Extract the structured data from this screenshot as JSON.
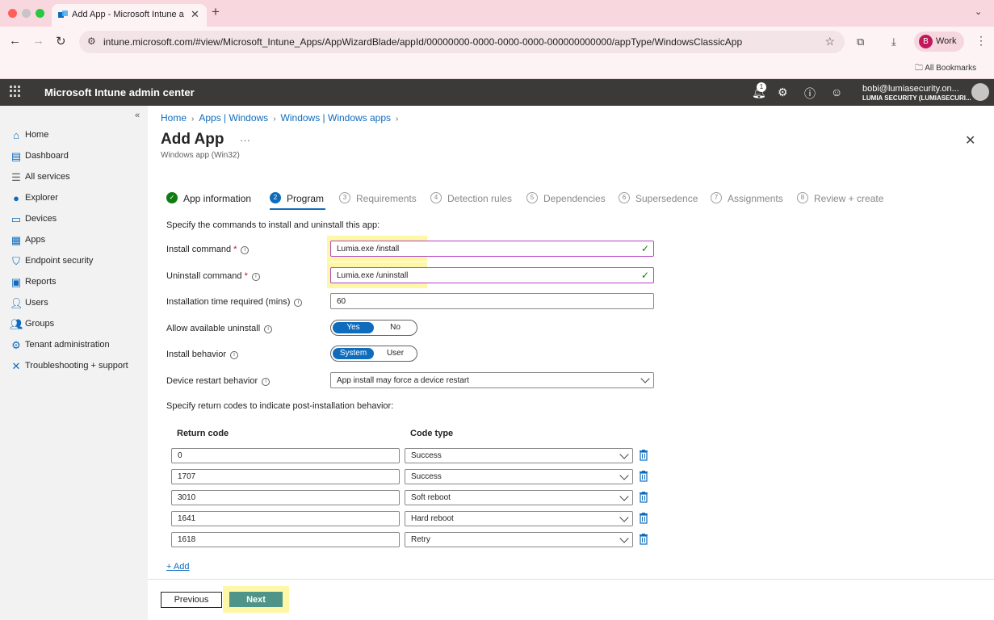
{
  "browser": {
    "tab_title": "Add App - Microsoft Intune a…",
    "url": "intune.microsoft.com/#view/Microsoft_Intune_Apps/AppWizardBlade/appId/00000000-0000-0000-0000-000000000000/appType/WindowsClassicApp",
    "profile_initial": "B",
    "profile_label": "Work",
    "bookmarks_label": "All Bookmarks"
  },
  "header": {
    "app_title": "Microsoft Intune admin center",
    "notification_count": "1",
    "user_email": "bobi@lumiasecurity.on...",
    "user_tenant": "LUMIA SECURITY (LUMIASECURI..."
  },
  "sidebar": {
    "items": [
      {
        "label": "Home",
        "icon": "home-icon"
      },
      {
        "label": "Dashboard",
        "icon": "dashboard-icon"
      },
      {
        "label": "All services",
        "icon": "list-icon"
      },
      {
        "label": "Explorer",
        "icon": "explorer-icon"
      },
      {
        "label": "Devices",
        "icon": "devices-icon"
      },
      {
        "label": "Apps",
        "icon": "apps-icon"
      },
      {
        "label": "Endpoint security",
        "icon": "shield-icon"
      },
      {
        "label": "Reports",
        "icon": "reports-icon"
      },
      {
        "label": "Users",
        "icon": "user-icon"
      },
      {
        "label": "Groups",
        "icon": "groups-icon"
      },
      {
        "label": "Tenant administration",
        "icon": "tenant-icon"
      },
      {
        "label": "Troubleshooting + support",
        "icon": "wrench-icon"
      }
    ]
  },
  "breadcrumb": [
    "Home",
    "Apps | Windows",
    "Windows | Windows apps"
  ],
  "page": {
    "title": "Add App",
    "subtitle": "Windows app (Win32)"
  },
  "steps": [
    {
      "num": "✓",
      "label": "App information",
      "state": "done"
    },
    {
      "num": "2",
      "label": "Program",
      "state": "active"
    },
    {
      "num": "3",
      "label": "Requirements",
      "state": "pending"
    },
    {
      "num": "4",
      "label": "Detection rules",
      "state": "pending"
    },
    {
      "num": "5",
      "label": "Dependencies",
      "state": "pending"
    },
    {
      "num": "6",
      "label": "Supersedence",
      "state": "pending"
    },
    {
      "num": "7",
      "label": "Assignments",
      "state": "pending"
    },
    {
      "num": "8",
      "label": "Review + create",
      "state": "pending"
    }
  ],
  "form": {
    "intro": "Specify the commands to install and uninstall this app:",
    "install_label": "Install command",
    "install_value": "Lumia.exe /install",
    "uninstall_label": "Uninstall command",
    "uninstall_value": "Lumia.exe /uninstall",
    "install_time_label": "Installation time required (mins)",
    "install_time_value": "60",
    "allow_uninstall_label": "Allow available uninstall",
    "allow_uninstall_options": [
      "Yes",
      "No"
    ],
    "install_behavior_label": "Install behavior",
    "install_behavior_options": [
      "System",
      "User"
    ],
    "restart_label": "Device restart behavior",
    "restart_value": "App install may force a device restart",
    "return_intro": "Specify return codes to indicate post-installation behavior:",
    "col_return_code": "Return code",
    "col_code_type": "Code type",
    "return_codes": [
      {
        "code": "0",
        "type": "Success"
      },
      {
        "code": "1707",
        "type": "Success"
      },
      {
        "code": "3010",
        "type": "Soft reboot"
      },
      {
        "code": "1641",
        "type": "Hard reboot"
      },
      {
        "code": "1618",
        "type": "Retry"
      }
    ],
    "add_label": "+ Add"
  },
  "footer": {
    "previous_label": "Previous",
    "next_label": "Next"
  },
  "colors": {
    "accent": "#0f6cbd",
    "success": "#107c10",
    "next_button": "#4e9488",
    "highlight": "#fdf7a6",
    "header_bg": "#3b3a39"
  }
}
